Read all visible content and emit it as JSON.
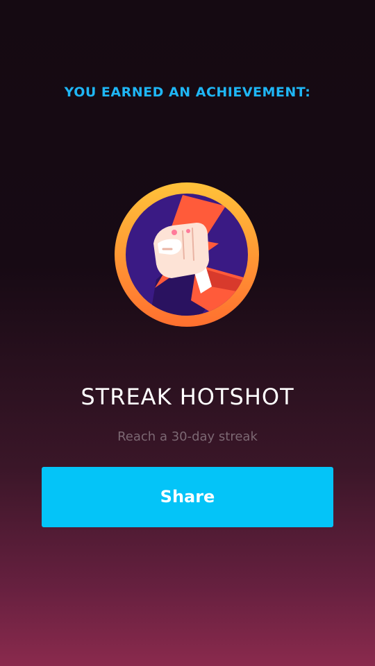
{
  "header": {
    "heading": "YOU EARNED AN ACHIEVEMENT:"
  },
  "achievement": {
    "badge_icon": "fist-lightning-icon",
    "title": "STREAK HOTSHOT",
    "description": "Reach a 30-day streak"
  },
  "actions": {
    "share_label": "Share"
  },
  "colors": {
    "accent": "#1fb6f5",
    "button": "#04c4f8",
    "badge_ring": "#ff9a2e",
    "badge_inner": "#3a1a84"
  }
}
